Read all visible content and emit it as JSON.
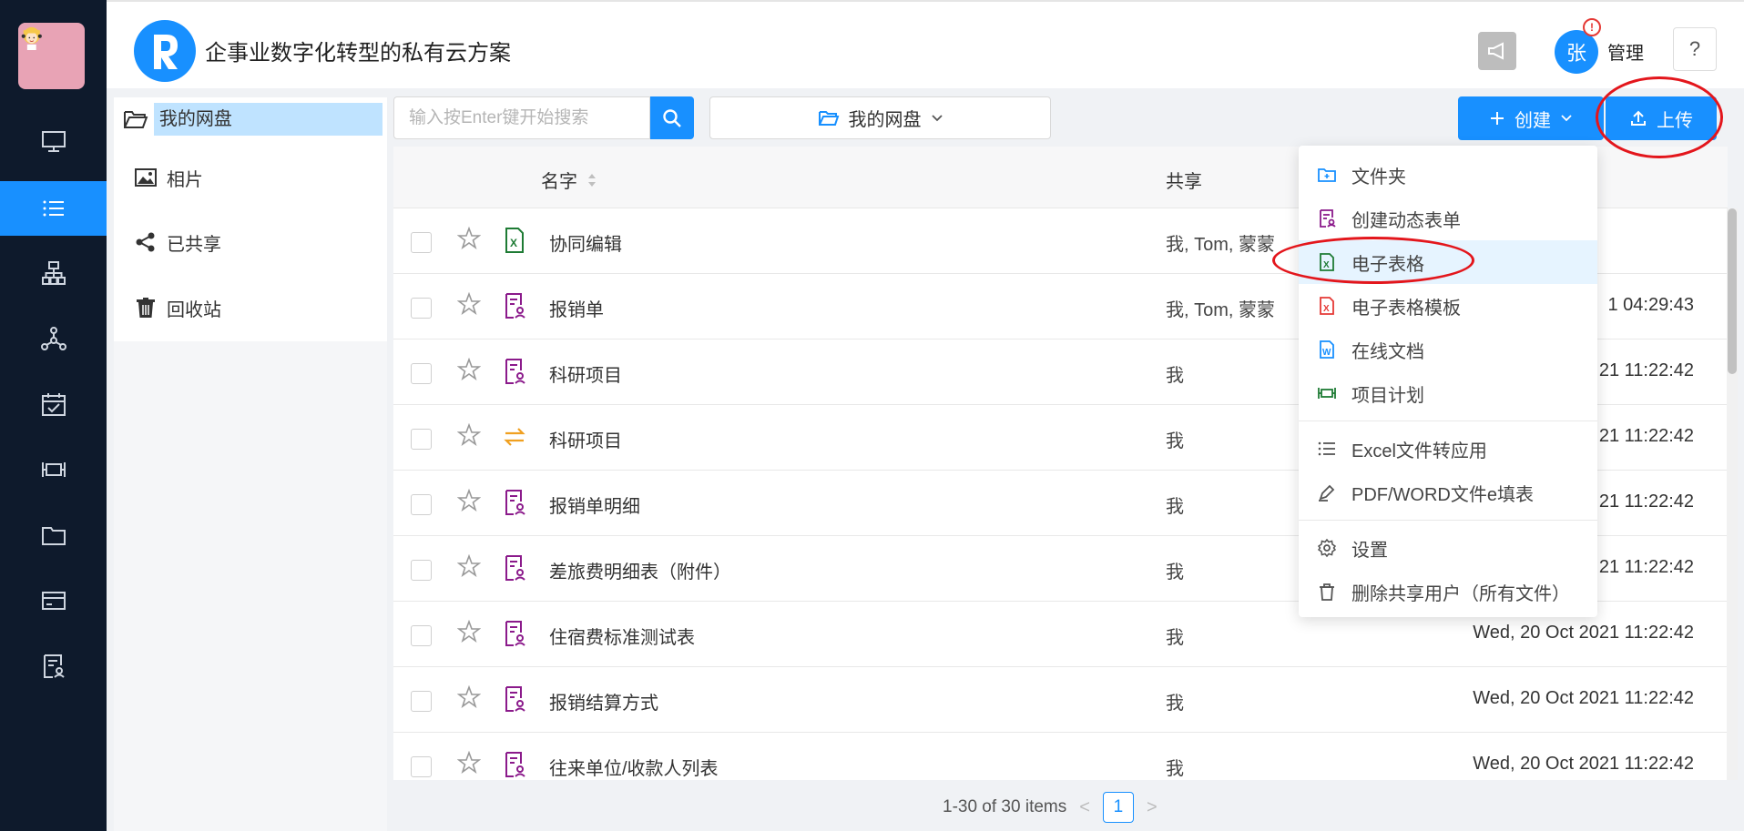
{
  "app": {
    "title": "企事业数字化转型的私有云方案",
    "logo_letter": "R",
    "brand_color": "#1890ff"
  },
  "user": {
    "avatar_char": "张",
    "badge": "!",
    "name": "管理"
  },
  "help_label": "?",
  "rail": {
    "items": [
      {
        "icon": "monitor-icon"
      },
      {
        "icon": "list-icon",
        "active": true
      },
      {
        "icon": "org-chart-icon"
      },
      {
        "icon": "network-icon"
      },
      {
        "icon": "calendar-check-icon"
      },
      {
        "icon": "project-icon"
      },
      {
        "icon": "folder-icon"
      },
      {
        "icon": "card-icon"
      },
      {
        "icon": "form-icon"
      }
    ]
  },
  "sidebar": {
    "root": "我的网盘",
    "items": [
      {
        "label": "相片",
        "icon": "image-icon"
      },
      {
        "label": "已共享",
        "icon": "share-icon"
      },
      {
        "label": "回收站",
        "icon": "trash-icon"
      }
    ]
  },
  "toolbar": {
    "search_placeholder": "输入按Enter键开始搜索",
    "path_label": "我的网盘",
    "create_label": "创建",
    "upload_label": "上传"
  },
  "table": {
    "columns": {
      "name": "名字",
      "share": "共享"
    },
    "rows": [
      {
        "name": "协同编辑",
        "share": "我, Tom, 蒙蒙",
        "date": "",
        "type": "excel"
      },
      {
        "name": "报销单",
        "share": "我, Tom, 蒙蒙",
        "date": "1 04:29:43",
        "type": "form"
      },
      {
        "name": "科研项目",
        "share": "我",
        "date": "21 11:22:42",
        "type": "form"
      },
      {
        "name": "科研项目",
        "share": "我",
        "date": "21 11:22:42",
        "type": "link"
      },
      {
        "name": "报销单明细",
        "share": "我",
        "date": "21 11:22:42",
        "type": "form"
      },
      {
        "name": "差旅费明细表（附件）",
        "share": "我",
        "date": "21 11:22:42",
        "type": "form"
      },
      {
        "name": "住宿费标准测试表",
        "share": "我",
        "date": "Wed, 20 Oct 2021 11:22:42",
        "type": "form"
      },
      {
        "name": "报销结算方式",
        "share": "我",
        "date": "Wed, 20 Oct 2021 11:22:42",
        "type": "form"
      },
      {
        "name": "往来单位/收款人列表",
        "share": "我",
        "date": "Wed, 20 Oct 2021 11:22:42",
        "type": "form"
      }
    ]
  },
  "pagination": {
    "summary": "1-30 of 30 items",
    "prev": "<",
    "current": "1",
    "next": ">"
  },
  "create_menu": {
    "items": [
      {
        "label": "文件夹",
        "icon": "new-folder-icon"
      },
      {
        "label": "创建动态表单",
        "icon": "dynamic-form-icon"
      },
      {
        "label": "电子表格",
        "icon": "spreadsheet-icon",
        "highlighted": true
      },
      {
        "label": "电子表格模板",
        "icon": "spreadsheet-template-icon"
      },
      {
        "label": "在线文档",
        "icon": "word-doc-icon"
      },
      {
        "label": "项目计划",
        "icon": "project-plan-icon"
      },
      {
        "label": "Excel文件转应用",
        "icon": "list-convert-icon"
      },
      {
        "label": "PDF/WORD文件e填表",
        "icon": "pen-fill-icon"
      },
      {
        "label": "设置",
        "icon": "settings-icon"
      },
      {
        "label": "删除共享用户（所有文件）",
        "icon": "delete-icon"
      }
    ]
  },
  "colors": {
    "rail_bg": "#0e1a2c",
    "accent": "#1890ff",
    "annotation": "#e3161c",
    "form_icon": "#8b1a8b",
    "excel_icon": "#1e7b34"
  }
}
